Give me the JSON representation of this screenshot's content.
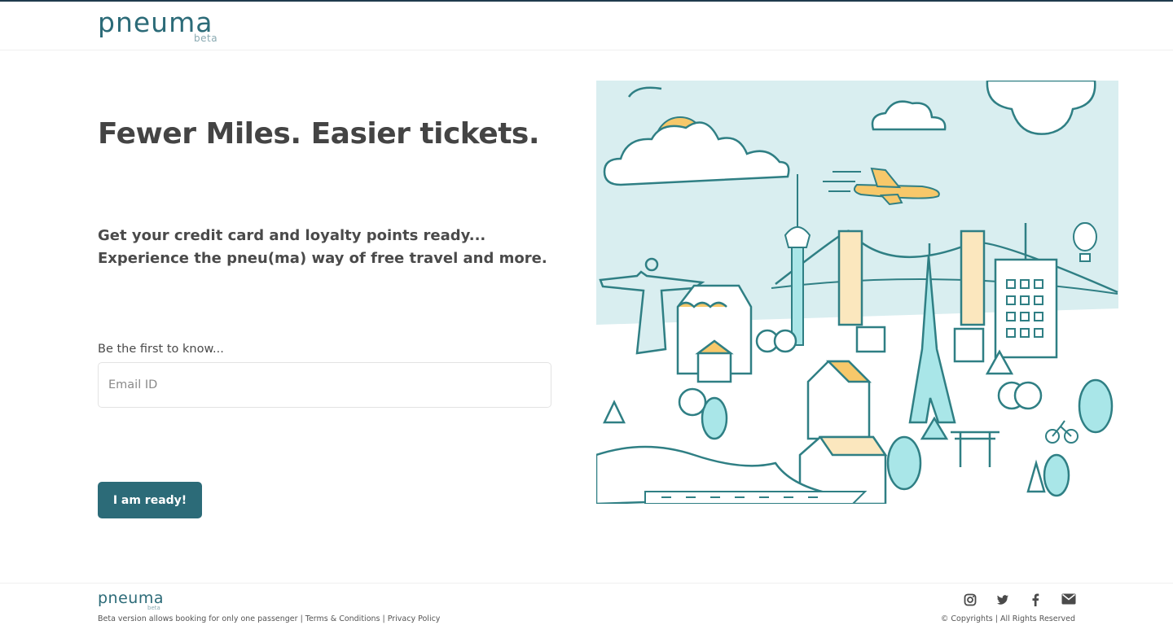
{
  "header": {
    "logo_text": "pneuma",
    "logo_badge": "beta"
  },
  "hero": {
    "title": "Fewer Miles. Easier tickets.",
    "subtitle_line1": "Get your credit card and loyalty points ready...",
    "subtitle_line2": "Experience the pneu(ma) way of free travel and more."
  },
  "signup": {
    "label": "Be the first to know...",
    "email_placeholder": "Email ID",
    "email_value": "",
    "submit_label": "I am ready!"
  },
  "illustration": {
    "description_icon": "city-travel-illustration"
  },
  "footer": {
    "logo_text": "pneuma",
    "logo_badge": "beta",
    "note": "Beta version allows booking for only one passenger",
    "terms_label": "Terms & Conditions",
    "privacy_label": "Privacy Policy",
    "separator": "|",
    "social": [
      "instagram-icon",
      "twitter-icon",
      "facebook-icon",
      "mail-icon"
    ],
    "copyright": "© Copyrights | All Rights Reserved"
  },
  "colors": {
    "brand": "#2c6b78",
    "sky": "#d9eef0",
    "accent_yellow": "#f7c86a",
    "line": "#2f7f84",
    "mint": "#a9e6e8"
  }
}
